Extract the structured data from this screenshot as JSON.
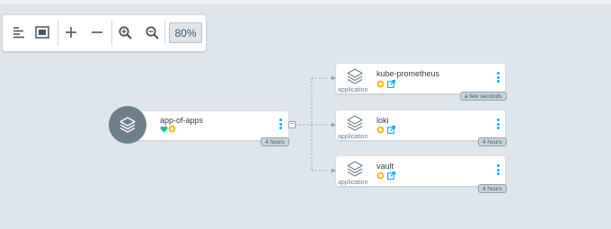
{
  "toolbar": {
    "zoom_level": "80%",
    "buttons": [
      "list-view",
      "fit-to-screen",
      "expand",
      "collapse",
      "zoom-in",
      "zoom-out"
    ]
  },
  "root_node": {
    "title": "app-of-apps",
    "health_icon": "heart-icon",
    "sync_icon": "sync-circle-icon",
    "age": "4 hours",
    "colors": {
      "health": "#18be94",
      "sync": "#f4c030",
      "circle": "#6d7f8b"
    }
  },
  "children": [
    {
      "title": "kube-prometheus",
      "kind": "application",
      "age": "a few seconds"
    },
    {
      "title": "loki",
      "kind": "application",
      "age": "4 hours"
    },
    {
      "title": "vault",
      "kind": "application",
      "age": "4 hours"
    }
  ],
  "colors": {
    "accent": "#0dadea",
    "background": "#dee6eb"
  }
}
